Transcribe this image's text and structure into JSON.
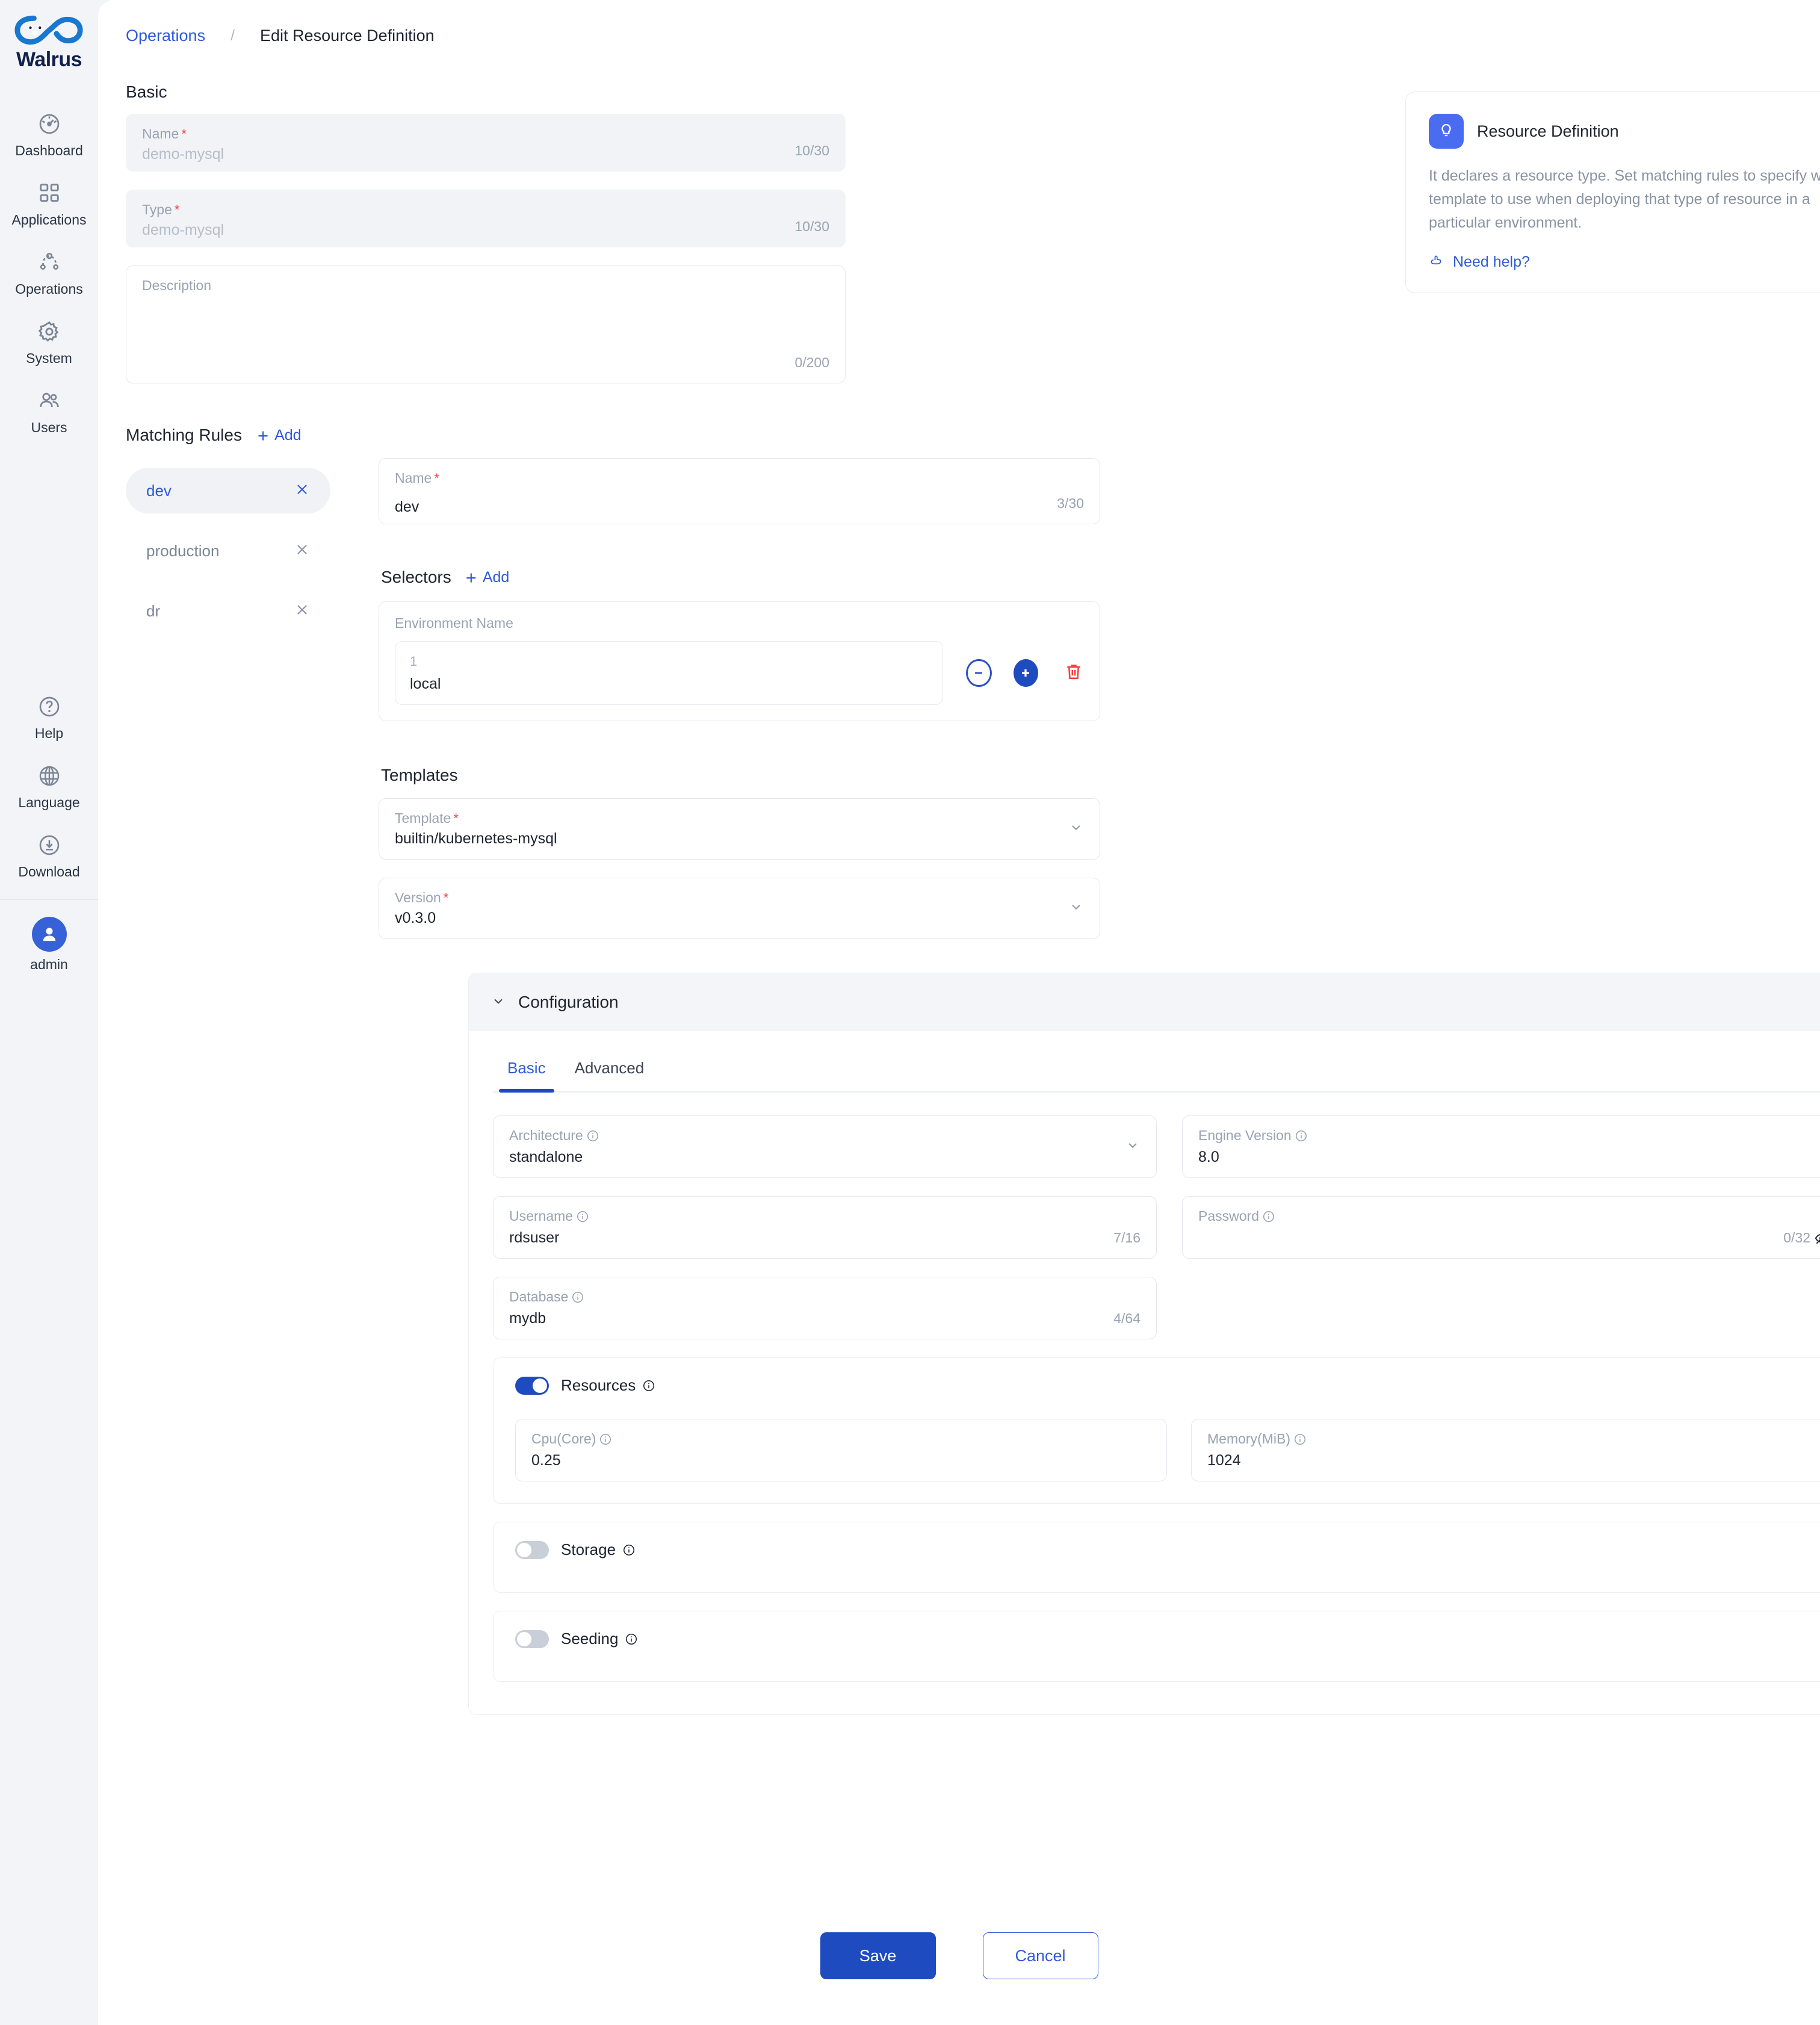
{
  "brand": {
    "name": "Walrus",
    "accent": "#1f4bc0",
    "logo_icon": "walrus-infinity-logo"
  },
  "sidebar": {
    "items": [
      {
        "label": "Dashboard",
        "icon": "dashboard-gauge-icon"
      },
      {
        "label": "Applications",
        "icon": "grid-squares-icon"
      },
      {
        "label": "Operations",
        "icon": "nodes-graph-icon"
      },
      {
        "label": "System",
        "icon": "gear-icon"
      },
      {
        "label": "Users",
        "icon": "users-icon"
      }
    ],
    "bottom_items": [
      {
        "label": "Help",
        "icon": "question-circle-icon"
      },
      {
        "label": "Language",
        "icon": "globe-icon"
      },
      {
        "label": "Download",
        "icon": "download-circle-icon"
      }
    ],
    "account": {
      "label": "admin",
      "icon": "user-avatar-icon"
    }
  },
  "breadcrumb": {
    "parent": "Operations",
    "separator": "/",
    "current": "Edit Resource Definition"
  },
  "basic": {
    "title": "Basic",
    "name": {
      "label": "Name",
      "required": "*",
      "value": "demo-mysql",
      "counter": "10/30",
      "readonly": true
    },
    "type": {
      "label": "Type",
      "required": "*",
      "value": "demo-mysql",
      "counter": "10/30",
      "readonly": true
    },
    "description": {
      "label": "Description",
      "value": "",
      "counter": "0/200"
    }
  },
  "info_card": {
    "icon": "lightbulb-icon",
    "title": "Resource Definition",
    "body": "It declares a resource type. Set matching rules to specify which template to use when deploying that type of resource in a particular environment.",
    "help_icon": "pointing-hand-icon",
    "help_label": "Need help?"
  },
  "matching_rules": {
    "title": "Matching Rules",
    "add_label": "Add",
    "add_icon": "plus-icon",
    "items": [
      {
        "label": "dev",
        "active": true,
        "close_icon": "close-x-icon"
      },
      {
        "label": "production",
        "active": false,
        "close_icon": "close-x-icon"
      },
      {
        "label": "dr",
        "active": false,
        "close_icon": "close-x-icon"
      }
    ],
    "rule_name": {
      "label": "Name",
      "required": "*",
      "value": "dev",
      "counter": "3/30"
    },
    "selectors": {
      "title": "Selectors",
      "add_label": "Add",
      "add_icon": "plus-icon",
      "group_label": "Environment Name",
      "rows": [
        {
          "index": "1",
          "value": "local"
        }
      ],
      "minus_icon": "minus-circle-icon",
      "plus_icon": "plus-circle-icon",
      "delete_icon": "trash-icon"
    }
  },
  "templates": {
    "title": "Templates",
    "template": {
      "label": "Template",
      "required": "*",
      "value": "builtin/kubernetes-mysql",
      "chevron_icon": "chevron-down-icon"
    },
    "version": {
      "label": "Version",
      "required": "*",
      "value": "v0.3.0",
      "chevron_icon": "chevron-down-icon"
    }
  },
  "configuration": {
    "title": "Configuration",
    "collapse_icon": "chevron-down-icon",
    "tabs": [
      {
        "label": "Basic",
        "active": true
      },
      {
        "label": "Advanced",
        "active": false
      }
    ],
    "fields": {
      "architecture": {
        "label": "Architecture",
        "info_icon": "info-circle-icon",
        "value": "standalone",
        "chevron_icon": "chevron-down-icon"
      },
      "engine_version": {
        "label": "Engine Version",
        "info_icon": "info-circle-icon",
        "value": "8.0"
      },
      "username": {
        "label": "Username",
        "info_icon": "info-circle-icon",
        "value": "rdsuser",
        "counter": "7/16"
      },
      "password": {
        "label": "Password",
        "info_icon": "info-circle-icon",
        "value": "",
        "counter": "0/32",
        "eye_icon": "eye-off-icon"
      },
      "database": {
        "label": "Database",
        "info_icon": "info-circle-icon",
        "value": "mydb",
        "counter": "4/64"
      }
    },
    "resources": {
      "label": "Resources",
      "info_icon": "info-circle-icon",
      "enabled": true,
      "cpu": {
        "label": "Cpu(Core)",
        "info_icon": "info-circle-icon",
        "value": "0.25"
      },
      "memory": {
        "label": "Memory(MiB)",
        "info_icon": "info-circle-icon",
        "value": "1024"
      }
    },
    "storage": {
      "label": "Storage",
      "info_icon": "info-circle-icon",
      "enabled": false
    },
    "seeding": {
      "label": "Seeding",
      "info_icon": "info-circle-icon",
      "enabled": false
    }
  },
  "footer": {
    "save_label": "Save",
    "cancel_label": "Cancel"
  }
}
